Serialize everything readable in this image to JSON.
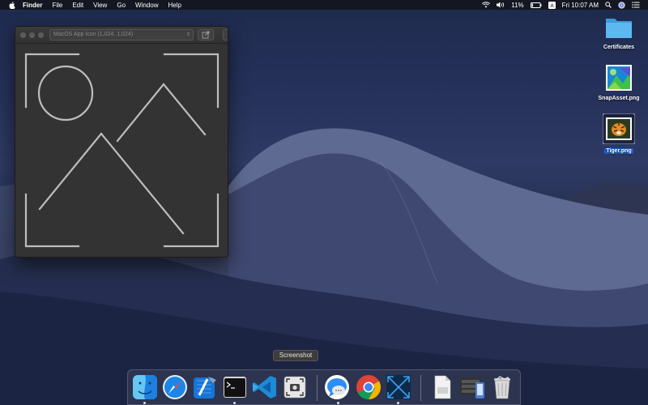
{
  "menubar": {
    "app_name": "Finder",
    "menus": [
      "File",
      "Edit",
      "View",
      "Go",
      "Window",
      "Help"
    ],
    "battery": "11%",
    "clock": "Fri 10:07 AM"
  },
  "window": {
    "document_select": "MacOS App Icon (1,024, 1,024)"
  },
  "desktop_icons": [
    {
      "label": "Certificates"
    },
    {
      "label": "SnapAsset.png"
    },
    {
      "label": "Tiger.png"
    }
  ],
  "dock": {
    "tooltip": "Screenshot",
    "items": [
      "finder-icon",
      "safari-icon",
      "xcode-icon",
      "terminal-icon",
      "vscode-icon",
      "screenshot-icon",
      "messages-icon",
      "chrome-icon",
      "instruments-icon",
      "document-icon",
      "simulator-icon",
      "trash-icon"
    ]
  },
  "colors": {
    "selection": "#1d5fd6",
    "window_bg": "#333333",
    "stroke": "#bdbdbd"
  }
}
